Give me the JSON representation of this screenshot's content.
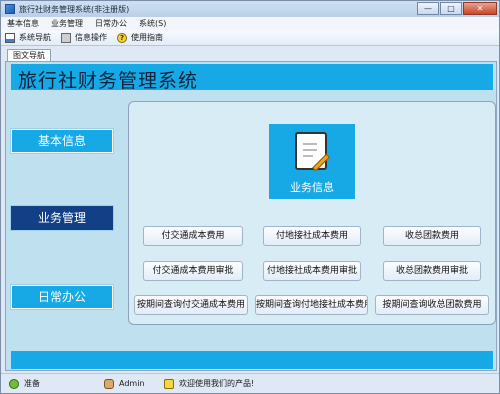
{
  "window": {
    "title": "旅行社财务管理系统(非注册版)"
  },
  "menu": [
    "基本信息",
    "业务管理",
    "日常办公",
    "系统(S)"
  ],
  "toolbar": {
    "system_nav": "系统导航",
    "info_ops": "信息操作",
    "guide": "使用指南"
  },
  "tab": {
    "label": "图文导航"
  },
  "banner": {
    "title": "旅行社财务管理系统"
  },
  "nav": {
    "basic": "基本信息",
    "business": "业务管理",
    "daily": "日常办公"
  },
  "feature": {
    "label": "业务信息"
  },
  "actions": {
    "row1": [
      "付交通成本费用",
      "付地接社成本费用",
      "收总团款费用"
    ],
    "row2": [
      "付交通成本费用审批",
      "付地接社成本费用审批",
      "收总团款费用审批"
    ],
    "row3": [
      "按期间查询付交通成本费用",
      "按期间查询付地接社成本费用",
      "按期间查询收总团款费用"
    ]
  },
  "status": {
    "ready": "准备",
    "user": "Admin",
    "message": "欢迎使用我们的产品!"
  }
}
